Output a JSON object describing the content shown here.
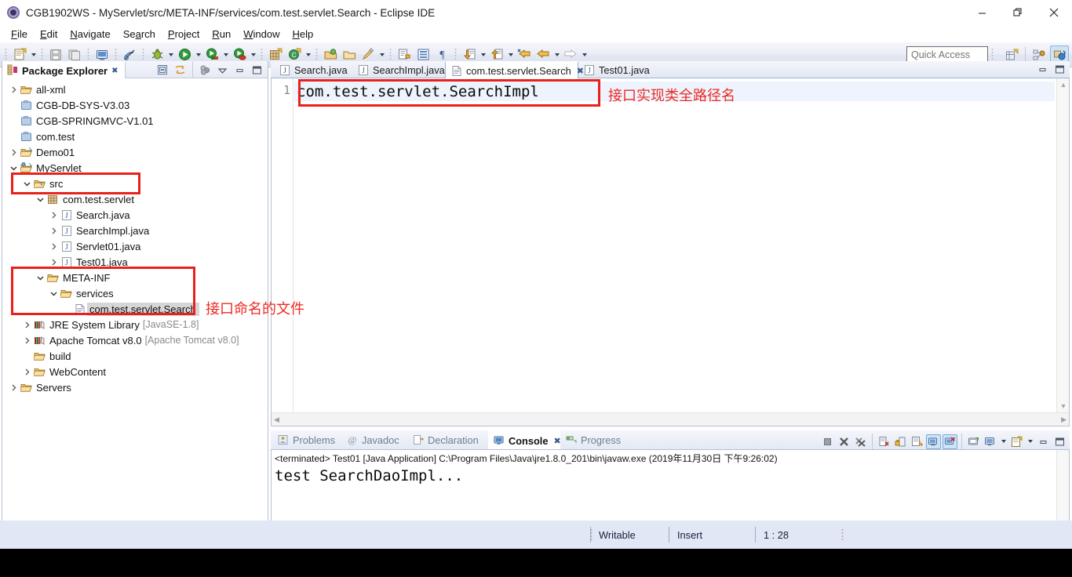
{
  "window": {
    "title": "CGB1902WS - MyServlet/src/META-INF/services/com.test.servlet.Search - Eclipse IDE",
    "app_icon": "eclipse-icon",
    "minimize": "—",
    "maximize": "❐",
    "close": "✕"
  },
  "menubar": {
    "items": [
      {
        "label": "File",
        "mnemonic": "F"
      },
      {
        "label": "Edit",
        "mnemonic": "E"
      },
      {
        "label": "Navigate",
        "mnemonic": "N"
      },
      {
        "label": "Search",
        "mnemonic": "a"
      },
      {
        "label": "Project",
        "mnemonic": "P"
      },
      {
        "label": "Run",
        "mnemonic": "R"
      },
      {
        "label": "Window",
        "mnemonic": "W"
      },
      {
        "label": "Help",
        "mnemonic": "H"
      }
    ]
  },
  "toolbar": {
    "quick_access_placeholder": "Quick Access",
    "quick_access_value": "",
    "buttons": [
      "new-wizard-icon",
      "save-icon",
      "save-all-icon",
      "print-icon",
      "toggle-mark-occurrences-icon",
      "debug-icon",
      "run-icon",
      "run-as-server-icon",
      "external-tools-icon",
      "new-java-package-icon",
      "new-java-class-icon",
      "open-type-icon",
      "open-task-icon",
      "search-icon",
      "next-annotation-icon",
      "previous-annotation-icon",
      "last-edit-location-icon",
      "back-icon",
      "forward-icon"
    ],
    "perspective_buttons": [
      "open-perspective-icon",
      "java-ee-perspective-icon",
      "java-perspective-icon"
    ]
  },
  "package_explorer": {
    "tab_label": "Package Explorer",
    "tab_icon": "package-explorer-icon",
    "tab_close": "✖",
    "tools": [
      "collapse-all-icon",
      "link-with-editor-icon",
      "view-menu-icon",
      "minimize-icon",
      "maximize-icon"
    ],
    "tree": [
      {
        "label": "all-xml",
        "indent": 0,
        "arrow": "right",
        "icon": "folder-open-icon",
        "selected": false
      },
      {
        "label": "CGB-DB-SYS-V3.03",
        "indent": 0,
        "arrow": "none",
        "icon": "closed-project-icon",
        "selected": false
      },
      {
        "label": "CGB-SPRINGMVC-V1.01",
        "indent": 0,
        "arrow": "none",
        "icon": "closed-project-icon",
        "selected": false
      },
      {
        "label": "com.test",
        "indent": 0,
        "arrow": "none",
        "icon": "closed-project-icon",
        "selected": false
      },
      {
        "label": "Demo01",
        "indent": 0,
        "arrow": "right",
        "icon": "java-project-icon",
        "selected": false
      },
      {
        "label": "MyServlet",
        "indent": 0,
        "arrow": "down",
        "icon": "web-project-icon",
        "selected": false
      },
      {
        "label": "src",
        "indent": 1,
        "arrow": "down",
        "icon": "source-folder-icon",
        "selected": false
      },
      {
        "label": "com.test.servlet",
        "indent": 2,
        "arrow": "down",
        "icon": "package-icon",
        "selected": false
      },
      {
        "label": "Search.java",
        "indent": 3,
        "arrow": "right",
        "icon": "java-interface-icon",
        "selected": false
      },
      {
        "label": "SearchImpl.java",
        "indent": 3,
        "arrow": "right",
        "icon": "java-class-icon",
        "selected": false
      },
      {
        "label": "Servlet01.java",
        "indent": 3,
        "arrow": "right",
        "icon": "java-class-icon",
        "selected": false
      },
      {
        "label": "Test01.java",
        "indent": 3,
        "arrow": "right",
        "icon": "java-class-icon",
        "selected": false
      },
      {
        "label": "META-INF",
        "indent": 2,
        "arrow": "down",
        "icon": "folder-open-icon",
        "selected": false
      },
      {
        "label": "services",
        "indent": 3,
        "arrow": "down",
        "icon": "folder-open-icon",
        "selected": false
      },
      {
        "label": "com.test.servlet.Search",
        "indent": 4,
        "arrow": "none",
        "icon": "file-icon",
        "selected": true
      },
      {
        "label": "JRE System Library",
        "indent": 1,
        "arrow": "right",
        "icon": "library-icon",
        "selected": false,
        "suffix": "[JavaSE-1.8]"
      },
      {
        "label": "Apache Tomcat v8.0",
        "indent": 1,
        "arrow": "right",
        "icon": "library-icon",
        "selected": false,
        "suffix": "[Apache Tomcat v8.0]"
      },
      {
        "label": "build",
        "indent": 1,
        "arrow": "none",
        "icon": "folder-open-icon",
        "selected": false
      },
      {
        "label": "WebContent",
        "indent": 1,
        "arrow": "right",
        "icon": "folder-open-icon",
        "selected": false
      },
      {
        "label": "Servers",
        "indent": 0,
        "arrow": "right",
        "icon": "folder-open-icon",
        "selected": false
      }
    ]
  },
  "editor": {
    "tabs": [
      {
        "label": "Search.java",
        "icon": "java-class-icon",
        "active": false
      },
      {
        "label": "SearchImpl.java",
        "icon": "java-class-icon",
        "active": false
      },
      {
        "label": "com.test.servlet.Search",
        "icon": "file-icon",
        "active": true
      },
      {
        "label": "Test01.java",
        "icon": "java-class-icon",
        "active": false
      }
    ],
    "close_glyph": "✖",
    "line_number": "1",
    "content": "com.test.servlet.SearchImpl",
    "tools": [
      "minimize-icon",
      "maximize-icon"
    ]
  },
  "console": {
    "tabs": [
      {
        "label": "Problems",
        "icon": "problems-icon",
        "active": false
      },
      {
        "label": "Javadoc",
        "icon": "javadoc-icon",
        "active": false
      },
      {
        "label": "Declaration",
        "icon": "declaration-icon",
        "active": false
      },
      {
        "label": "Console",
        "icon": "console-icon",
        "active": true
      },
      {
        "label": "Progress",
        "icon": "progress-icon",
        "active": false
      }
    ],
    "close_glyph": "✖",
    "tools": [
      "terminate-icon",
      "remove-launch-icon",
      "remove-all-terminated-icon",
      "clear-console-icon",
      "scroll-lock-icon",
      "word-wrap-icon",
      "show-console-on-output-icon",
      "show-console-on-error-icon",
      "pin-console-icon",
      "display-selected-console-icon",
      "open-console-icon",
      "minimize-icon",
      "maximize-icon"
    ],
    "terminated_line": "<terminated> Test01 [Java Application] C:\\Program Files\\Java\\jre1.8.0_201\\bin\\javaw.exe (2019年11月30日 下午9:26:02)",
    "output": "test SearchDaoImpl..."
  },
  "statusbar": {
    "writable": "Writable",
    "insert": "Insert",
    "position": "1 : 28"
  },
  "annotations": {
    "editor_note": "接口实现类全路径名",
    "tree_note": "接口命名的文件",
    "box_color": "#e8211c",
    "text_color": "#ee2a22"
  }
}
